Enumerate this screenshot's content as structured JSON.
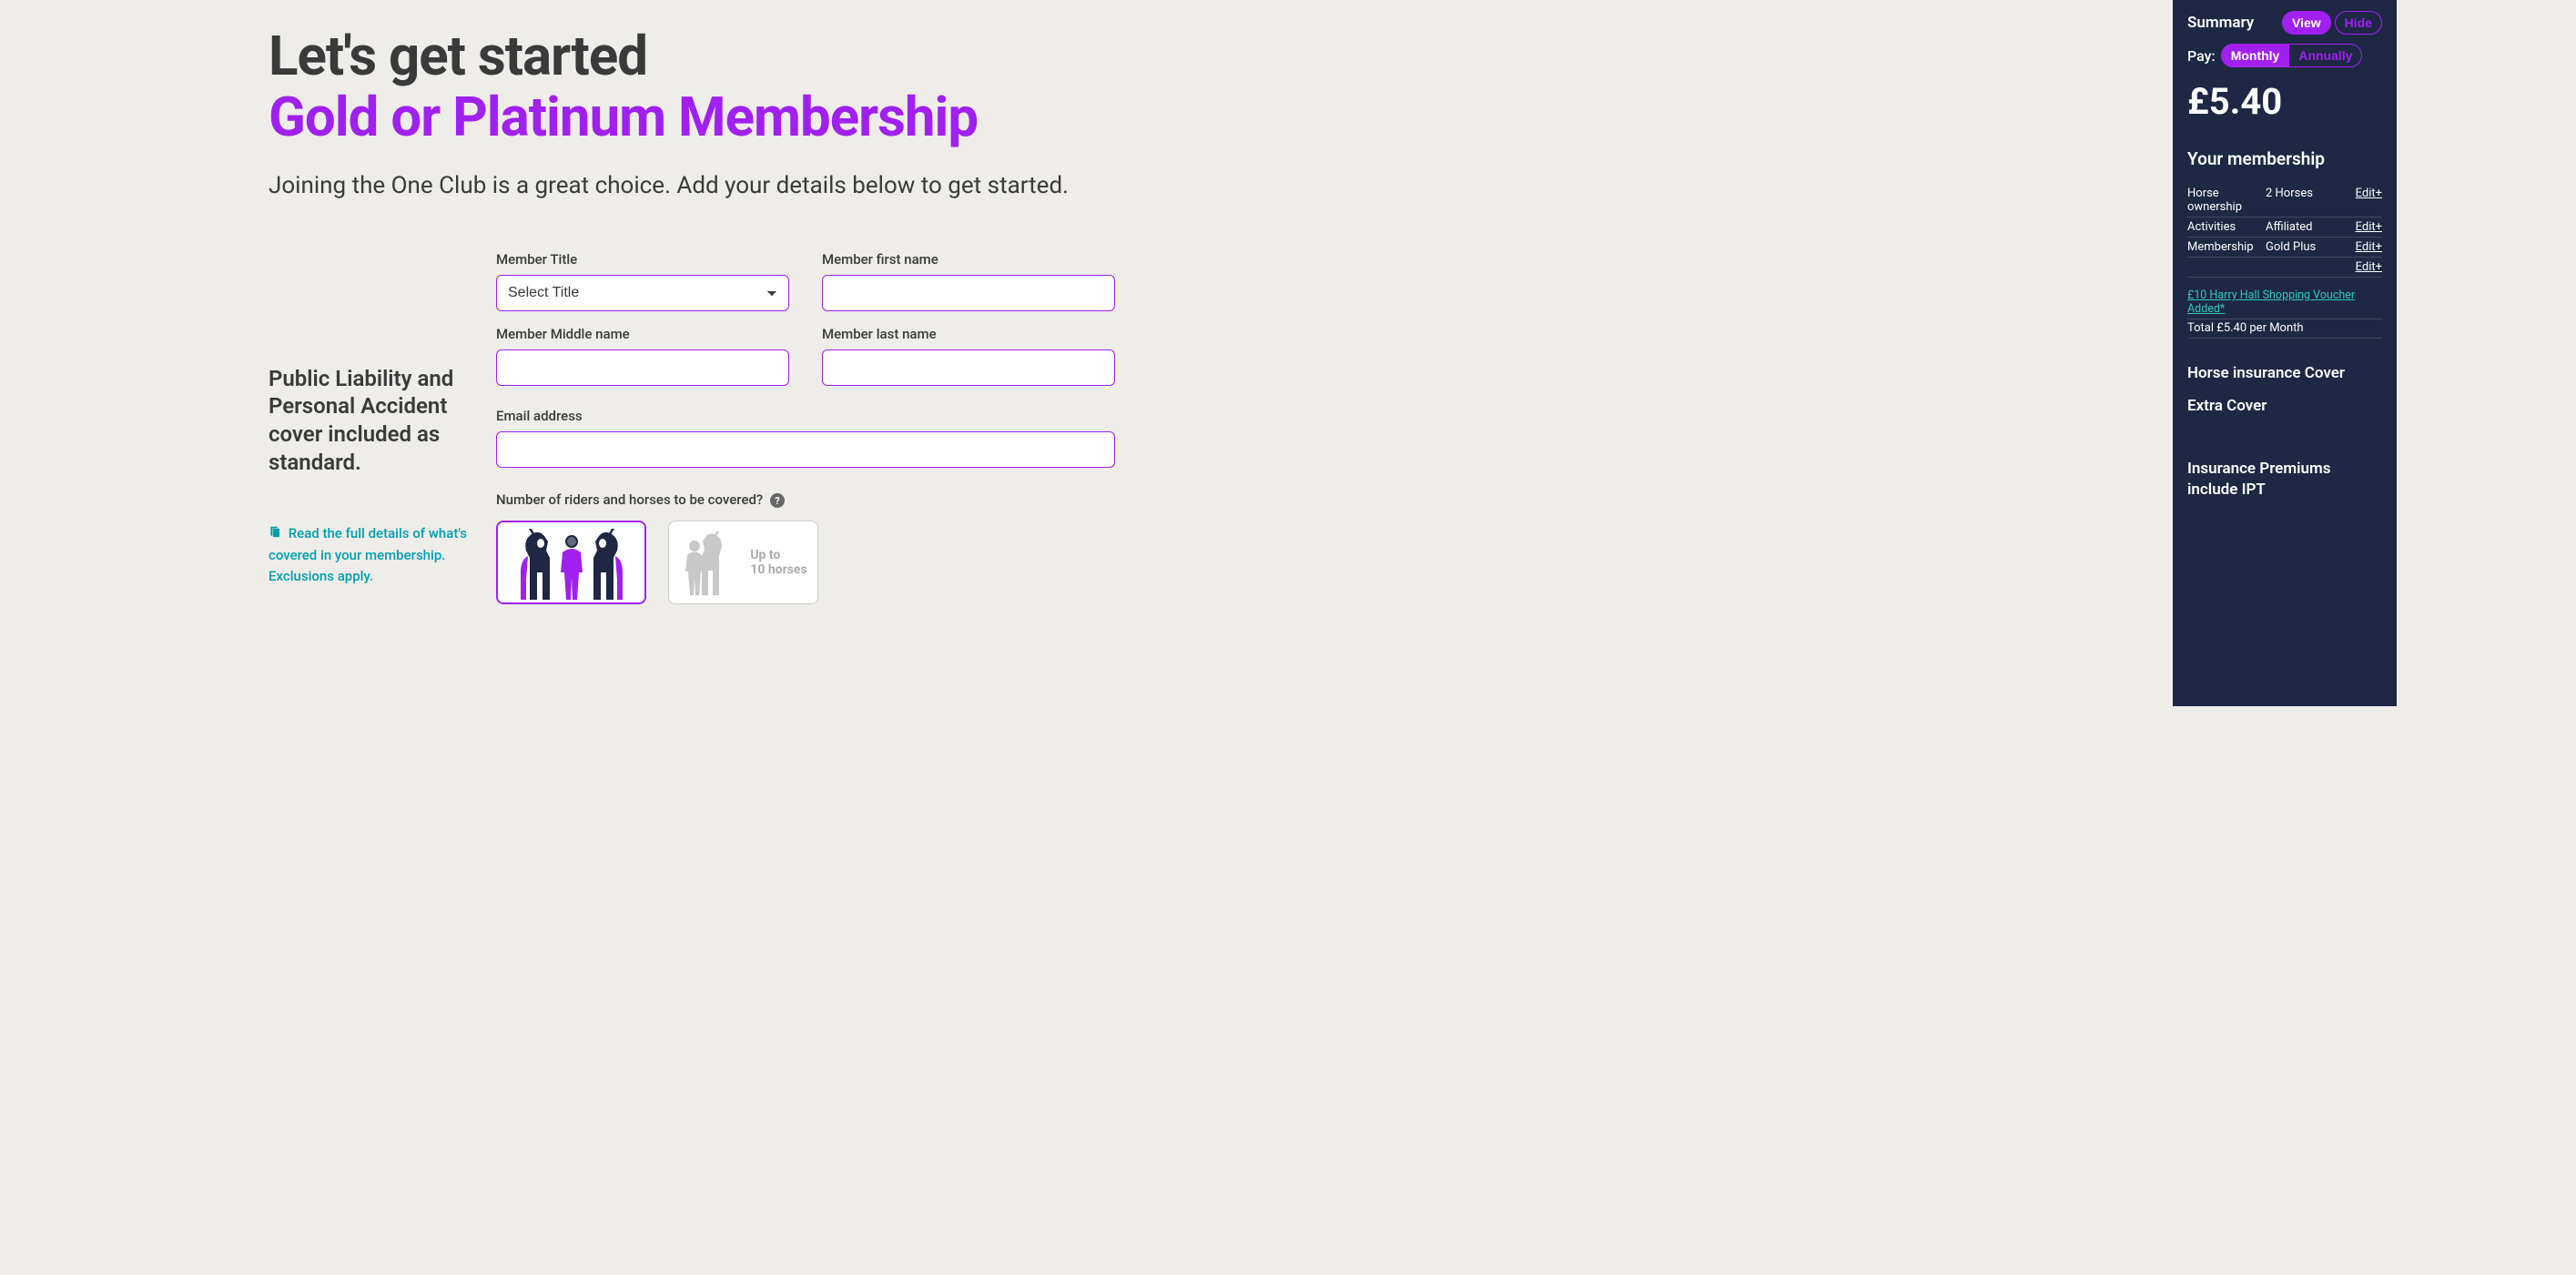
{
  "heading": {
    "line1": "Let's get started",
    "line2": "Gold or Platinum Membership"
  },
  "intro": "Joining the One Club is a great choice. Add your details below to get started.",
  "form": {
    "title_label": "Member Title",
    "title_selected": "Select Title",
    "first_name_label": "Member first name",
    "middle_name_label": "Member Middle name",
    "last_name_label": "Member last name",
    "email_label": "Email address",
    "riders_label": "Number of riders and horses to be covered?",
    "card_upto_line1": "Up to",
    "card_upto_line2": "10 horses"
  },
  "info": {
    "text": "Public Liability and Personal Accident cover included as standard.",
    "link": "Read the full details of what's covered in your membership. Exclusions apply."
  },
  "sidebar": {
    "summary_label": "Summary",
    "view": "View",
    "hide": "Hide",
    "pay_label": "Pay:",
    "monthly": "Monthly",
    "annually": "Annually",
    "price": "£5.40",
    "membership_heading": "Your membership",
    "rows": [
      {
        "label": "Horse ownership",
        "value": "2 Horses",
        "edit": "Edit+"
      },
      {
        "label": "Activities",
        "value": "Affiliated",
        "edit": "Edit+"
      },
      {
        "label": "Membership",
        "value": "Gold Plus",
        "edit": "Edit+"
      },
      {
        "label": "",
        "value": "",
        "edit": "Edit+"
      }
    ],
    "voucher": "£10 Harry Hall Shopping Voucher Added*",
    "total": "Total £5.40 per Month",
    "horse_ins": "Horse insurance Cover",
    "extra": "Extra Cover",
    "ipt": "Insurance Premiums include IPT"
  }
}
